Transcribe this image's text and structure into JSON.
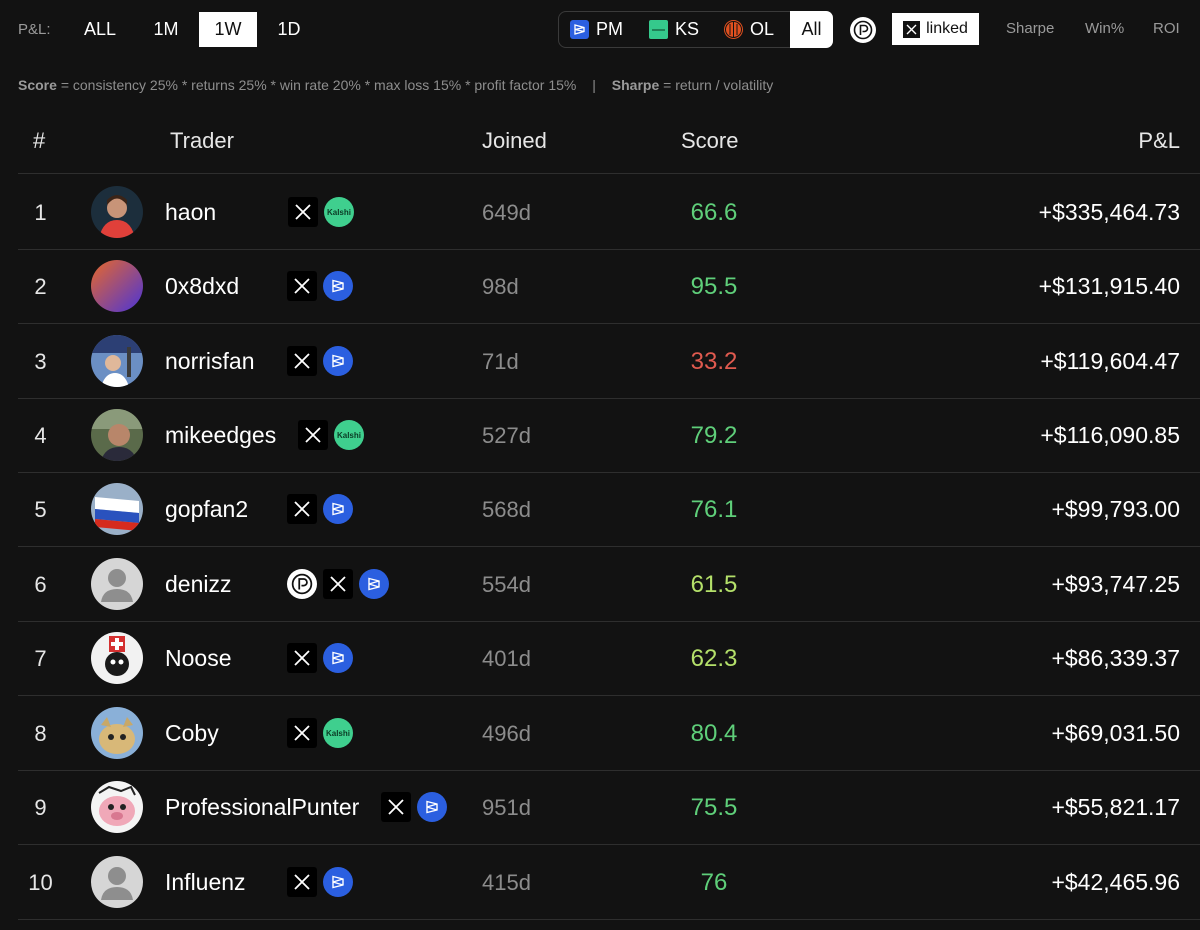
{
  "filters": {
    "pnl_label": "P&L:",
    "periods": [
      "ALL",
      "1M",
      "1W",
      "1D"
    ],
    "active_period": "1W",
    "sources": [
      {
        "label": "PM",
        "icon": "polymarket-icon"
      },
      {
        "label": "KS",
        "icon": "kalshi-icon"
      },
      {
        "label": "OL",
        "icon": "ol-icon"
      },
      {
        "label": "All",
        "icon": ""
      }
    ],
    "active_source": "All",
    "linked_label": "linked",
    "metrics": [
      "Sharpe",
      "Win%",
      "ROI"
    ]
  },
  "formula": {
    "score_term": "Score",
    "score_text": "= consistency 25% * returns 25% * win rate 20% * max loss 15% * profit factor 15%",
    "separator": "|",
    "sharpe_term": "Sharpe",
    "sharpe_text": "= return / volatility"
  },
  "table": {
    "headers": {
      "rank": "#",
      "trader": "Trader",
      "joined": "Joined",
      "score": "Score",
      "pnl": "P&L"
    },
    "rows": [
      {
        "rank": "1",
        "name": "haon",
        "badges": [
          "x",
          "kalshi"
        ],
        "joined": "649d",
        "score": "66.6",
        "score_color": "#5fcf7a",
        "pnl": "+$335,464.73"
      },
      {
        "rank": "2",
        "name": "0x8dxd",
        "badges": [
          "x",
          "polymarket"
        ],
        "joined": "98d",
        "score": "95.5",
        "score_color": "#5fcf7a",
        "pnl": "+$131,915.40"
      },
      {
        "rank": "3",
        "name": "norrisfan",
        "badges": [
          "x",
          "polymarket"
        ],
        "joined": "71d",
        "score": "33.2",
        "score_color": "#e05a4f",
        "pnl": "+$119,604.47"
      },
      {
        "rank": "4",
        "name": "mikeedges",
        "badges": [
          "x",
          "kalshi"
        ],
        "joined": "527d",
        "score": "79.2",
        "score_color": "#5fcf7a",
        "pnl": "+$116,090.85"
      },
      {
        "rank": "5",
        "name": "gopfan2",
        "badges": [
          "x",
          "polymarket"
        ],
        "joined": "568d",
        "score": "76.1",
        "score_color": "#5fcf7a",
        "pnl": "+$99,793.00"
      },
      {
        "rank": "6",
        "name": "denizz",
        "badges": [
          "circle",
          "x",
          "polymarket"
        ],
        "joined": "554d",
        "score": "61.5",
        "score_color": "#b4e06a",
        "pnl": "+$93,747.25"
      },
      {
        "rank": "7",
        "name": "Noose",
        "badges": [
          "x",
          "polymarket"
        ],
        "joined": "401d",
        "score": "62.3",
        "score_color": "#b4e06a",
        "pnl": "+$86,339.37"
      },
      {
        "rank": "8",
        "name": "Coby",
        "badges": [
          "x",
          "kalshi"
        ],
        "joined": "496d",
        "score": "80.4",
        "score_color": "#5fcf7a",
        "pnl": "+$69,031.50"
      },
      {
        "rank": "9",
        "name": "ProfessionalPunter",
        "badges": [
          "x",
          "polymarket"
        ],
        "joined": "951d",
        "score": "75.5",
        "score_color": "#5fcf7a",
        "pnl": "+$55,821.17"
      },
      {
        "rank": "10",
        "name": "Influenz",
        "badges": [
          "x",
          "polymarket"
        ],
        "joined": "415d",
        "score": "76",
        "score_color": "#5fcf7a",
        "pnl": "+$42,465.96"
      }
    ]
  },
  "colors": {
    "background": "#121212",
    "score_green": "#5fcf7a",
    "score_lime": "#b4e06a",
    "score_red": "#e05a4f",
    "polymarket_blue": "#2b5fe0",
    "kalshi_green": "#3fcf8e"
  }
}
